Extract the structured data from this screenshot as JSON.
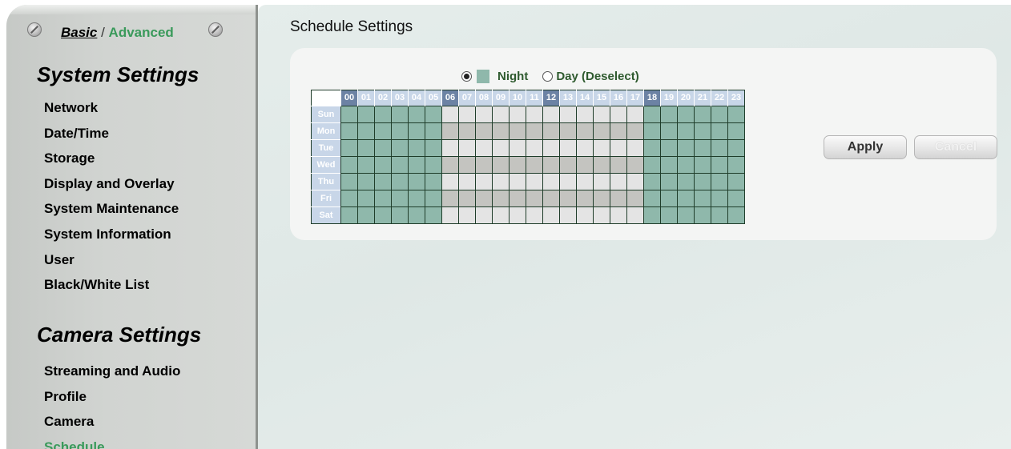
{
  "sidebar": {
    "mode_basic": "Basic",
    "mode_separator": " / ",
    "mode_advanced": "Advanced",
    "system_title": "System Settings",
    "system_items": [
      "Network",
      "Date/Time",
      "Storage",
      "Display and Overlay",
      "System Maintenance",
      "System Information",
      "User",
      "Black/White List"
    ],
    "camera_title": "Camera Settings",
    "camera_items": [
      "Streaming and Audio",
      "Profile",
      "Camera",
      "Schedule"
    ],
    "active_item": "Schedule"
  },
  "main": {
    "title": "Schedule Settings",
    "mode": {
      "night_label": "Night",
      "day_label": "Day (Deselect)",
      "selected": "night"
    },
    "schedule": {
      "hours": [
        "00",
        "01",
        "02",
        "03",
        "04",
        "05",
        "06",
        "07",
        "08",
        "09",
        "10",
        "11",
        "12",
        "13",
        "14",
        "15",
        "16",
        "17",
        "18",
        "19",
        "20",
        "21",
        "22",
        "23"
      ],
      "highlighted_hours": [
        "00",
        "06",
        "12",
        "18"
      ],
      "days": [
        "Sun",
        "Mon",
        "Tue",
        "Wed",
        "Thu",
        "Fri",
        "Sat"
      ],
      "night_hours": [
        0,
        1,
        2,
        3,
        4,
        5,
        18,
        19,
        20,
        21,
        22,
        23
      ]
    },
    "apply_label": "Apply",
    "cancel_label": "Cancel"
  },
  "colors": {
    "night": "#8fb8ab",
    "day_light": "#e4e4e4",
    "day_dark": "#c4c4c0",
    "active_nav": "#3a9a5b"
  }
}
